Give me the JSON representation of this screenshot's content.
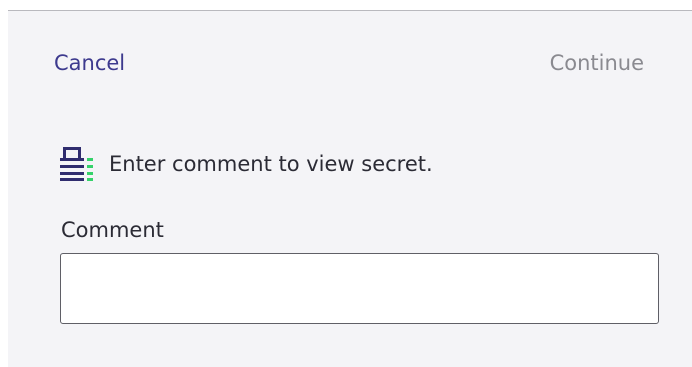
{
  "header": {
    "cancel_label": "Cancel",
    "continue_label": "Continue"
  },
  "prompt": {
    "icon": "secret-lock-icon",
    "text": "Enter comment to view secret."
  },
  "form": {
    "comment_label": "Comment",
    "comment_value": "",
    "comment_placeholder": ""
  },
  "colors": {
    "cancel": "#3d3a8e",
    "continue_disabled": "#8a8a90",
    "panel_background": "#f4f4f7",
    "icon_dark": "#2f2c6e",
    "icon_accent": "#35d26a"
  }
}
